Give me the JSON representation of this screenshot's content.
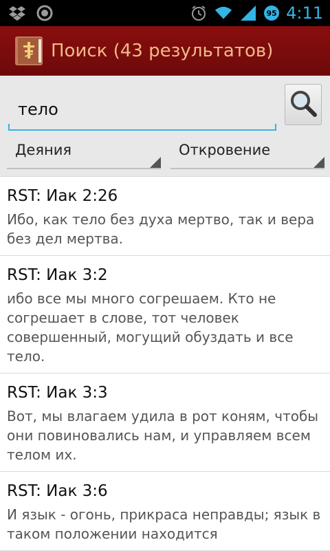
{
  "status_bar": {
    "time": "4:11",
    "battery_level": "95",
    "left_icons": [
      "dropbox-icon",
      "sync-icon"
    ],
    "right_icons": [
      "alarm-icon",
      "wifi-icon",
      "signal-icon",
      "battery-icon"
    ]
  },
  "action_bar": {
    "title": "Поиск (43 результатов)",
    "app_icon": "bible-book-icon"
  },
  "search": {
    "query": "тело",
    "button_icon": "search-icon",
    "range_from": "Деяния",
    "range_to": "Откровение"
  },
  "results": [
    {
      "ref": "RST: Иак 2:26",
      "text": "Ибо, как тело без духа мертво, так и вера без дел мертва."
    },
    {
      "ref": "RST: Иак 3:2",
      "text": "ибо все мы много согрешаем. Кто не согрешает в слове, тот человек совершенный, могущий обуздать и все тело."
    },
    {
      "ref": "RST: Иак 3:3",
      "text": "Вот, мы влагаем удила в рот коням, чтобы они повиновались нам, и управляем всем телом их."
    },
    {
      "ref": "RST: Иак 3:6",
      "text": "И язык - огонь, прикраса неправды; язык в таком положении находится"
    }
  ],
  "colors": {
    "accent": "#33b5e5",
    "action_bar": "#7a0c0c",
    "title_text": "#f2b98a"
  }
}
